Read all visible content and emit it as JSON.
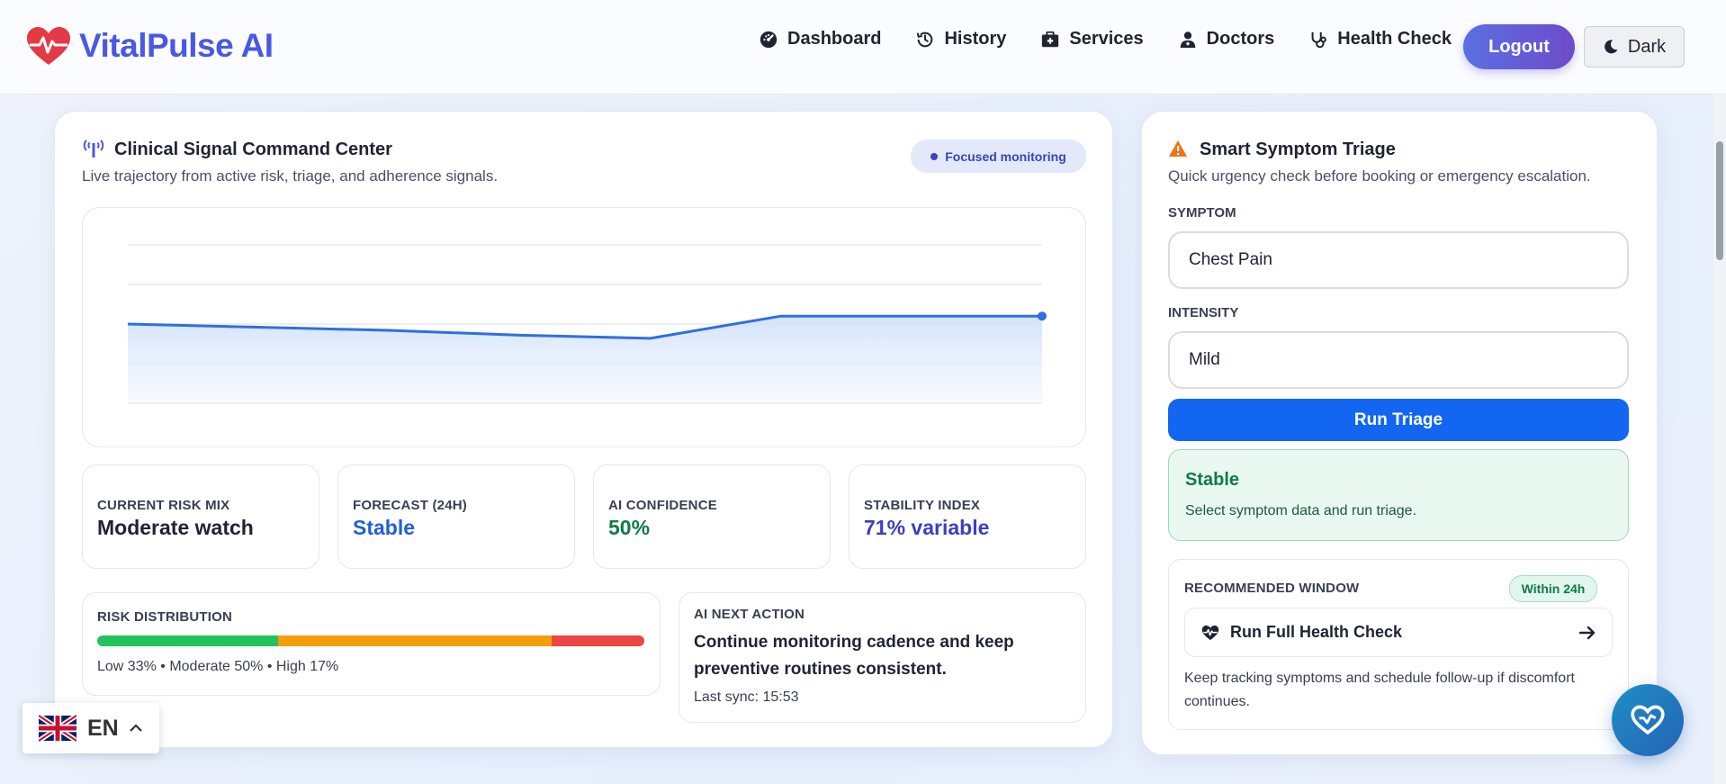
{
  "brand": {
    "name": "VitalPulse AI",
    "color": "#4a58e4",
    "icon": "heart-pulse-icon"
  },
  "nav": [
    {
      "label": "Dashboard",
      "icon": "gauge-icon"
    },
    {
      "label": "History",
      "icon": "history-icon"
    },
    {
      "label": "Services",
      "icon": "medkit-icon"
    },
    {
      "label": "Doctors",
      "icon": "doctor-icon"
    },
    {
      "label": "Health Check",
      "icon": "stethoscope-icon"
    }
  ],
  "header": {
    "logout_label": "Logout",
    "theme_label": "Dark"
  },
  "command_center": {
    "title": "Clinical Signal Command Center",
    "subtitle": "Live trajectory from active risk, triage, and adherence signals.",
    "badge": "Focused monitoring",
    "stats": [
      {
        "label": "CURRENT RISK MIX",
        "value": "Moderate watch",
        "color": "#1f2433"
      },
      {
        "label": "FORECAST (24H)",
        "value": "Stable",
        "color": "#1f5fd6"
      },
      {
        "label": "AI CONFIDENCE",
        "value": "50%",
        "color": "#0f7a4a"
      },
      {
        "label": "STABILITY INDEX",
        "value": "71% variable",
        "color": "#3b3fc1"
      }
    ],
    "risk_distribution": {
      "label": "RISK DISTRIBUTION",
      "segments": [
        {
          "name": "Low",
          "percent": 33,
          "color": "#22c35e"
        },
        {
          "name": "Moderate",
          "percent": 50,
          "color": "#f59e0b"
        },
        {
          "name": "High",
          "percent": 17,
          "color": "#ef4444"
        }
      ],
      "summary": "Low 33% • Moderate 50% • High 17%"
    },
    "next_action": {
      "label": "AI NEXT ACTION",
      "text": "Continue monitoring cadence and keep preventive routines consistent.",
      "sync": "Last sync: 15:53"
    }
  },
  "chart_data": {
    "type": "area",
    "x": [
      0,
      1,
      2,
      3,
      4,
      5,
      6,
      7
    ],
    "values": [
      50,
      48,
      46,
      43,
      41,
      55,
      55,
      55
    ],
    "ylim": [
      0,
      100
    ],
    "grid": true,
    "color": "#2f6ee3"
  },
  "triage": {
    "title": "Smart Symptom Triage",
    "subtitle": "Quick urgency check before booking or emergency escalation.",
    "symptom_label": "SYMPTOM",
    "symptom_value": "Chest Pain",
    "intensity_label": "INTENSITY",
    "intensity_value": "Mild",
    "run_label": "Run Triage",
    "result_title": "Stable",
    "result_text": "Select symptom data and run triage.",
    "window_label": "RECOMMENDED WINDOW",
    "window_badge": "Within 24h",
    "check_label": "Run Full Health Check",
    "window_note": "Keep tracking symptoms and schedule follow-up if discomfort continues."
  },
  "language": {
    "code": "EN"
  }
}
